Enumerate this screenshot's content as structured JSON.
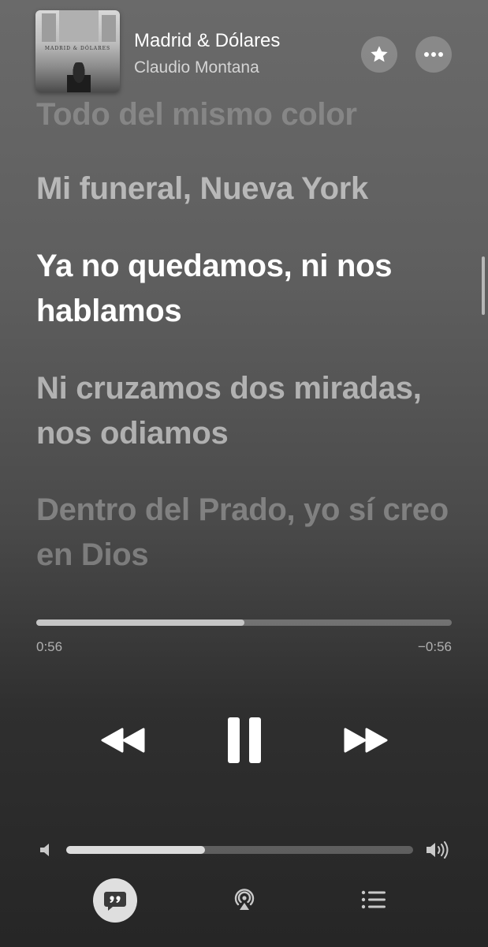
{
  "now_playing": {
    "title": "Madrid & Dólares",
    "artist": "Claudio Montana",
    "album_art_text": "MADRID & DÓLARES"
  },
  "header_buttons": {
    "favorite_icon": "star-icon",
    "more_icon": "ellipsis-icon"
  },
  "lyrics": [
    "Todo del mismo color",
    "Mi funeral, Nueva York",
    "Ya no quedamos, ni nos hablamos",
    "Ni cruzamos dos miradas, nos odiamos",
    "Dentro del Prado, yo sí creo en Dios"
  ],
  "active_lyric_index": 2,
  "playback": {
    "elapsed": "0:56",
    "remaining": "−0:56",
    "progress_fraction": 0.5
  },
  "volume": {
    "level_fraction": 0.4
  },
  "controls": {
    "rewind_icon": "rewind-icon",
    "pause_icon": "pause-icon",
    "forward_icon": "fast-forward-icon"
  },
  "bottom_bar": {
    "lyrics_icon": "quote-bubble-icon",
    "airplay_icon": "airplay-audio-icon",
    "queue_icon": "list-icon"
  },
  "colors": {
    "text_primary": "#ffffff",
    "text_secondary": "#d4d4d4"
  }
}
